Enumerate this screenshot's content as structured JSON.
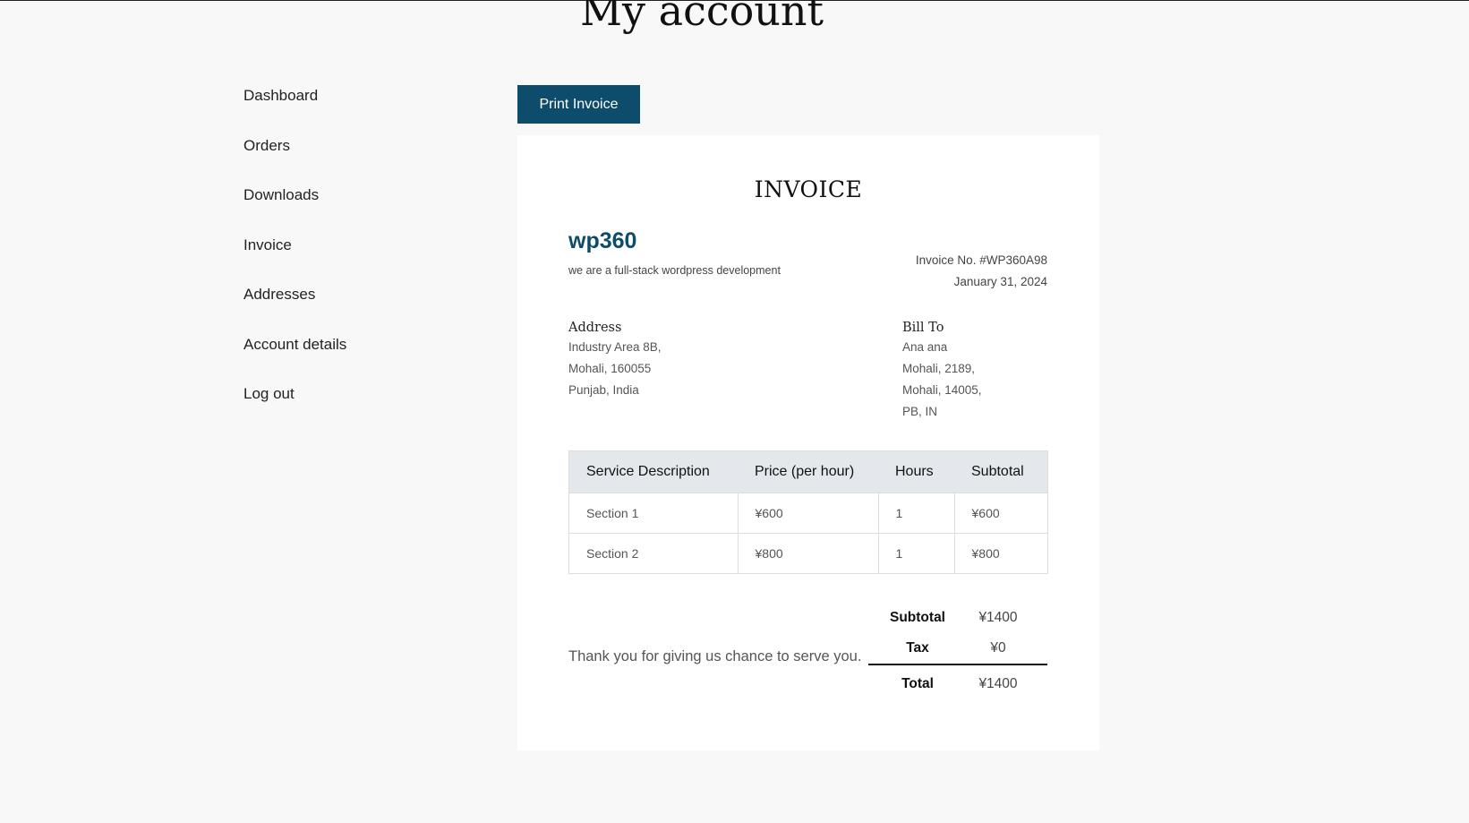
{
  "page": {
    "title": "My account"
  },
  "nav": {
    "items": [
      {
        "label": "Dashboard"
      },
      {
        "label": "Orders"
      },
      {
        "label": "Downloads"
      },
      {
        "label": "Invoice"
      },
      {
        "label": "Addresses"
      },
      {
        "label": "Account details"
      },
      {
        "label": "Log out"
      }
    ]
  },
  "toolbar": {
    "print_label": "Print Invoice"
  },
  "invoice": {
    "heading": "INVOICE",
    "brand": "wp360",
    "tagline": "we are a full-stack wordpress development",
    "number": "Invoice No. #WP360A98",
    "date": "January 31, 2024",
    "address": {
      "title": "Address",
      "lines": [
        "Industry Area 8B,",
        "Mohali, 160055",
        "Punjab, India"
      ]
    },
    "bill_to": {
      "title": "Bill To",
      "lines": [
        "Ana ana",
        "Mohali, 2189,",
        "Mohali, 14005,",
        "PB, IN"
      ]
    },
    "table": {
      "headers": [
        "Service Description",
        "Price (per hour)",
        "Hours",
        "Subtotal"
      ],
      "rows": [
        [
          "Section 1",
          "¥600",
          "1",
          "¥600"
        ],
        [
          "Section 2",
          "¥800",
          "1",
          "¥800"
        ]
      ]
    },
    "thanks": "Thank you for giving us chance to serve you.",
    "totals": {
      "subtotal_label": "Subtotal",
      "subtotal_value": "¥1400",
      "tax_label": "Tax",
      "tax_value": "¥0",
      "total_label": "Total",
      "total_value": "¥1400"
    }
  },
  "colors": {
    "accent": "#0d4d6b",
    "table_header_bg": "#e4e8ec",
    "page_bg": "#f8f8f8"
  }
}
